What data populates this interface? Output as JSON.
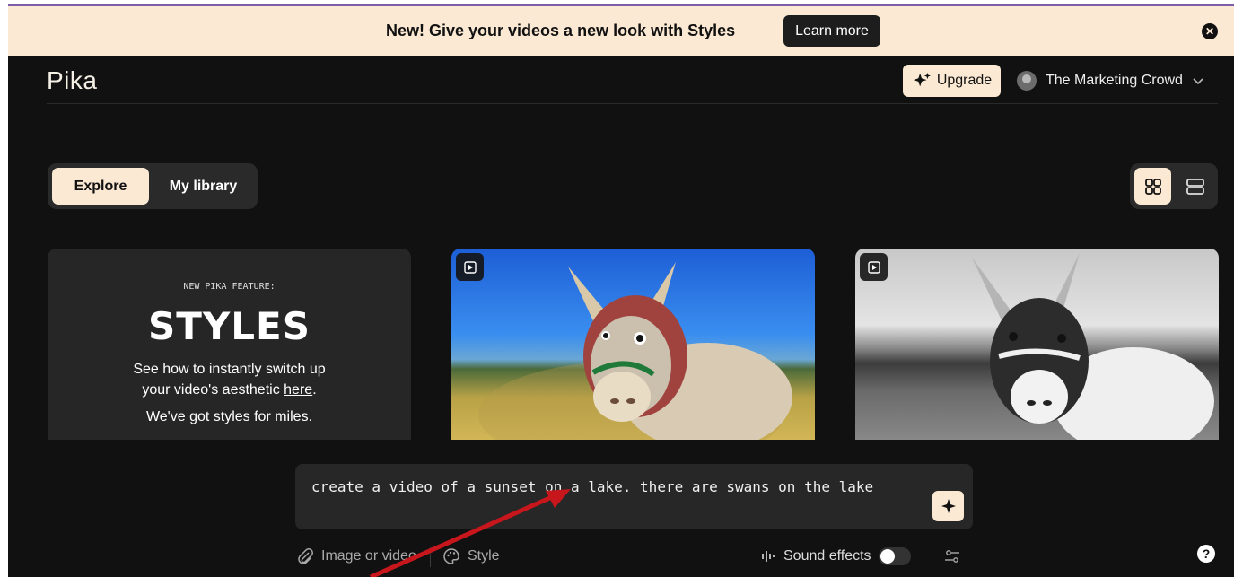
{
  "banner": {
    "text": "New! Give your videos a new look with Styles",
    "button_label": "Learn more",
    "close_icon": "close-icon"
  },
  "header": {
    "logo": "Pika",
    "upgrade_label": "Upgrade",
    "account_name": "The Marketing Crowd"
  },
  "tabs": [
    {
      "label": "Explore",
      "active": true
    },
    {
      "label": "My library",
      "active": false
    }
  ],
  "view_modes": [
    "grid-view-icon",
    "list-view-icon"
  ],
  "promo_card": {
    "kicker": "NEW PIKA FEATURE:",
    "title": "STYLES",
    "desc_part1": "See how to instantly switch up",
    "desc_part2": "your video's aesthetic ",
    "link": "here",
    "desc_part3": ".",
    "more": "We've got styles for miles."
  },
  "video_cards": [
    {
      "icon": "play-icon",
      "palette": "color"
    },
    {
      "icon": "play-icon",
      "palette": "black-and-white"
    }
  ],
  "prompt": {
    "value": "create a video of a sunset on a lake. there are swans on the lake"
  },
  "toolbar": {
    "attach_label": "Image or video",
    "style_label": "Style",
    "sound_label": "Sound effects",
    "sound_enabled": false
  },
  "help_label": "?",
  "colors": {
    "accent": "#fbe9d3",
    "background": "#111111",
    "annotation_arrow": "#c8161d"
  }
}
